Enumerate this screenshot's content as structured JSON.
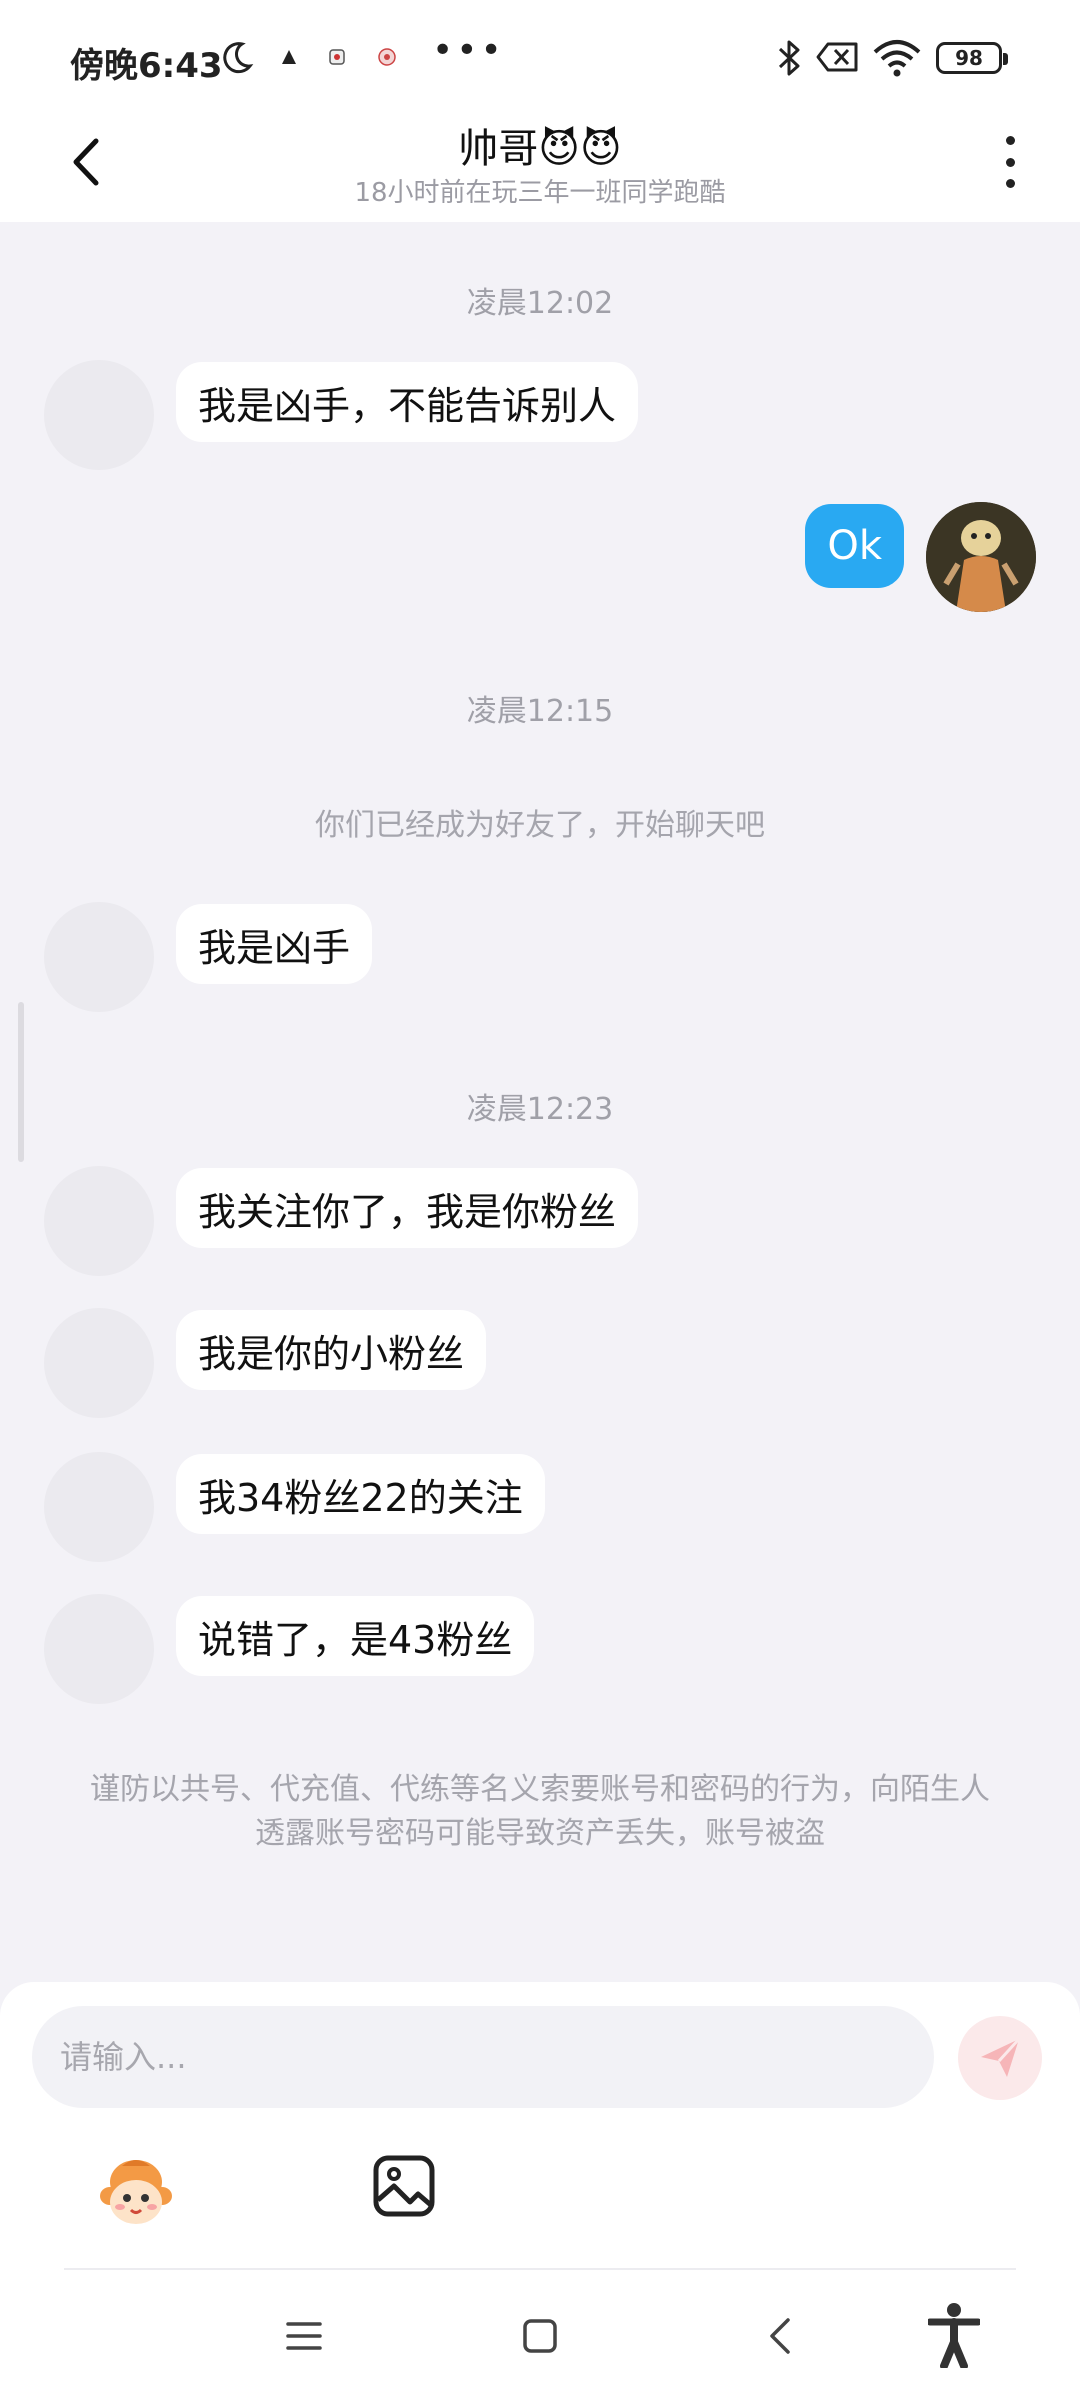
{
  "status_bar": {
    "time": "傍晚6:43",
    "dots": "•••",
    "battery": "98",
    "icons": [
      "moon-icon",
      "bluetooth-icon",
      "no-sim-icon",
      "wifi-icon",
      "battery-icon"
    ]
  },
  "header": {
    "title": "帅哥😈😈",
    "subtitle": "18小时前在玩三年一班同学跑酷"
  },
  "chat": {
    "timestamps": [
      "凌晨12:02",
      "凌晨12:15",
      "凌晨12:23"
    ],
    "system_note": "你们已经成为好友了，开始聊天吧",
    "messages": [
      {
        "from": "them",
        "text": "我是凶手，不能告诉别人"
      },
      {
        "from": "me",
        "text": "Ok"
      },
      {
        "from": "them",
        "text": "我是凶手"
      },
      {
        "from": "them",
        "text": "我关注你了，我是你粉丝"
      },
      {
        "from": "them",
        "text": "我是你的小粉丝"
      },
      {
        "from": "them",
        "text": "我34粉丝22的关注"
      },
      {
        "from": "them",
        "text": "说错了，是43粉丝"
      }
    ],
    "warning": "谨防以共号、代充值、代练等名义索要账号和密码的行为，向陌生人透露账号密码可能导致资产丢失，账号被盗"
  },
  "input": {
    "placeholder": "请输入..."
  },
  "colors": {
    "outgoing_bubble": "#29a9f2",
    "background": "#f3f2f7",
    "send_button": "#fbe9ea",
    "send_arrow": "#f6b5b8"
  }
}
